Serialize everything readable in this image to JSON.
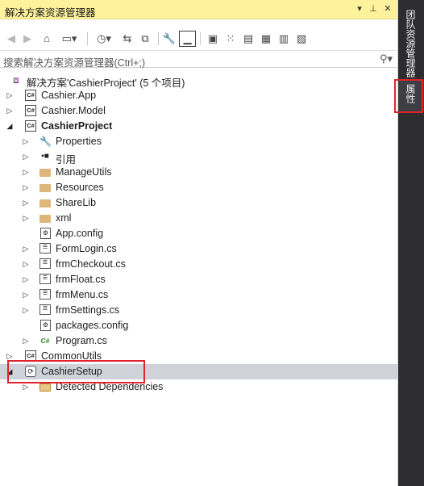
{
  "panel": {
    "title": "解决方案资源管理器",
    "title_buttons": [
      "▾",
      "⊥",
      "✕"
    ]
  },
  "toolbar": {
    "icons": [
      "back-icon",
      "forward-icon",
      "home-icon",
      "switch-views-icon",
      "history-icon",
      "sync-icon",
      "collapse-all-icon",
      "properties-wrench-icon",
      "preview-icon",
      "vsix-icon-1",
      "vsix-icon-2",
      "vsix-icon-3",
      "vsix-icon-4",
      "vsix-icon-5"
    ]
  },
  "search": {
    "placeholder": "搜索解决方案资源管理器(Ctrl+;)"
  },
  "tree": {
    "solution": "解决方案'CashierProject' (5 个项目)",
    "items": [
      {
        "label": "Cashier.App"
      },
      {
        "label": "Cashier.Model"
      },
      {
        "label": "CashierProject"
      },
      {
        "label": "Properties"
      },
      {
        "label": "引用"
      },
      {
        "label": "ManageUtils"
      },
      {
        "label": "Resources"
      },
      {
        "label": "ShareLib"
      },
      {
        "label": "xml"
      },
      {
        "label": "App.config"
      },
      {
        "label": "FormLogin.cs"
      },
      {
        "label": "frmCheckout.cs"
      },
      {
        "label": "frmFloat.cs"
      },
      {
        "label": "frmMenu.cs"
      },
      {
        "label": "frmSettings.cs"
      },
      {
        "label": "packages.config"
      },
      {
        "label": "Program.cs"
      },
      {
        "label": "CommonUtils"
      },
      {
        "label": "CashierSetup"
      },
      {
        "label": "Detected Dependencies"
      }
    ]
  },
  "right_rail": {
    "tabs": [
      "团队资源管理器",
      "属性"
    ]
  },
  "colors": {
    "title_bg": "#fff29d",
    "selection_bg": "#cfd2d9",
    "highlight_box": "#e0232d",
    "rail_bg": "#2d2d30"
  }
}
